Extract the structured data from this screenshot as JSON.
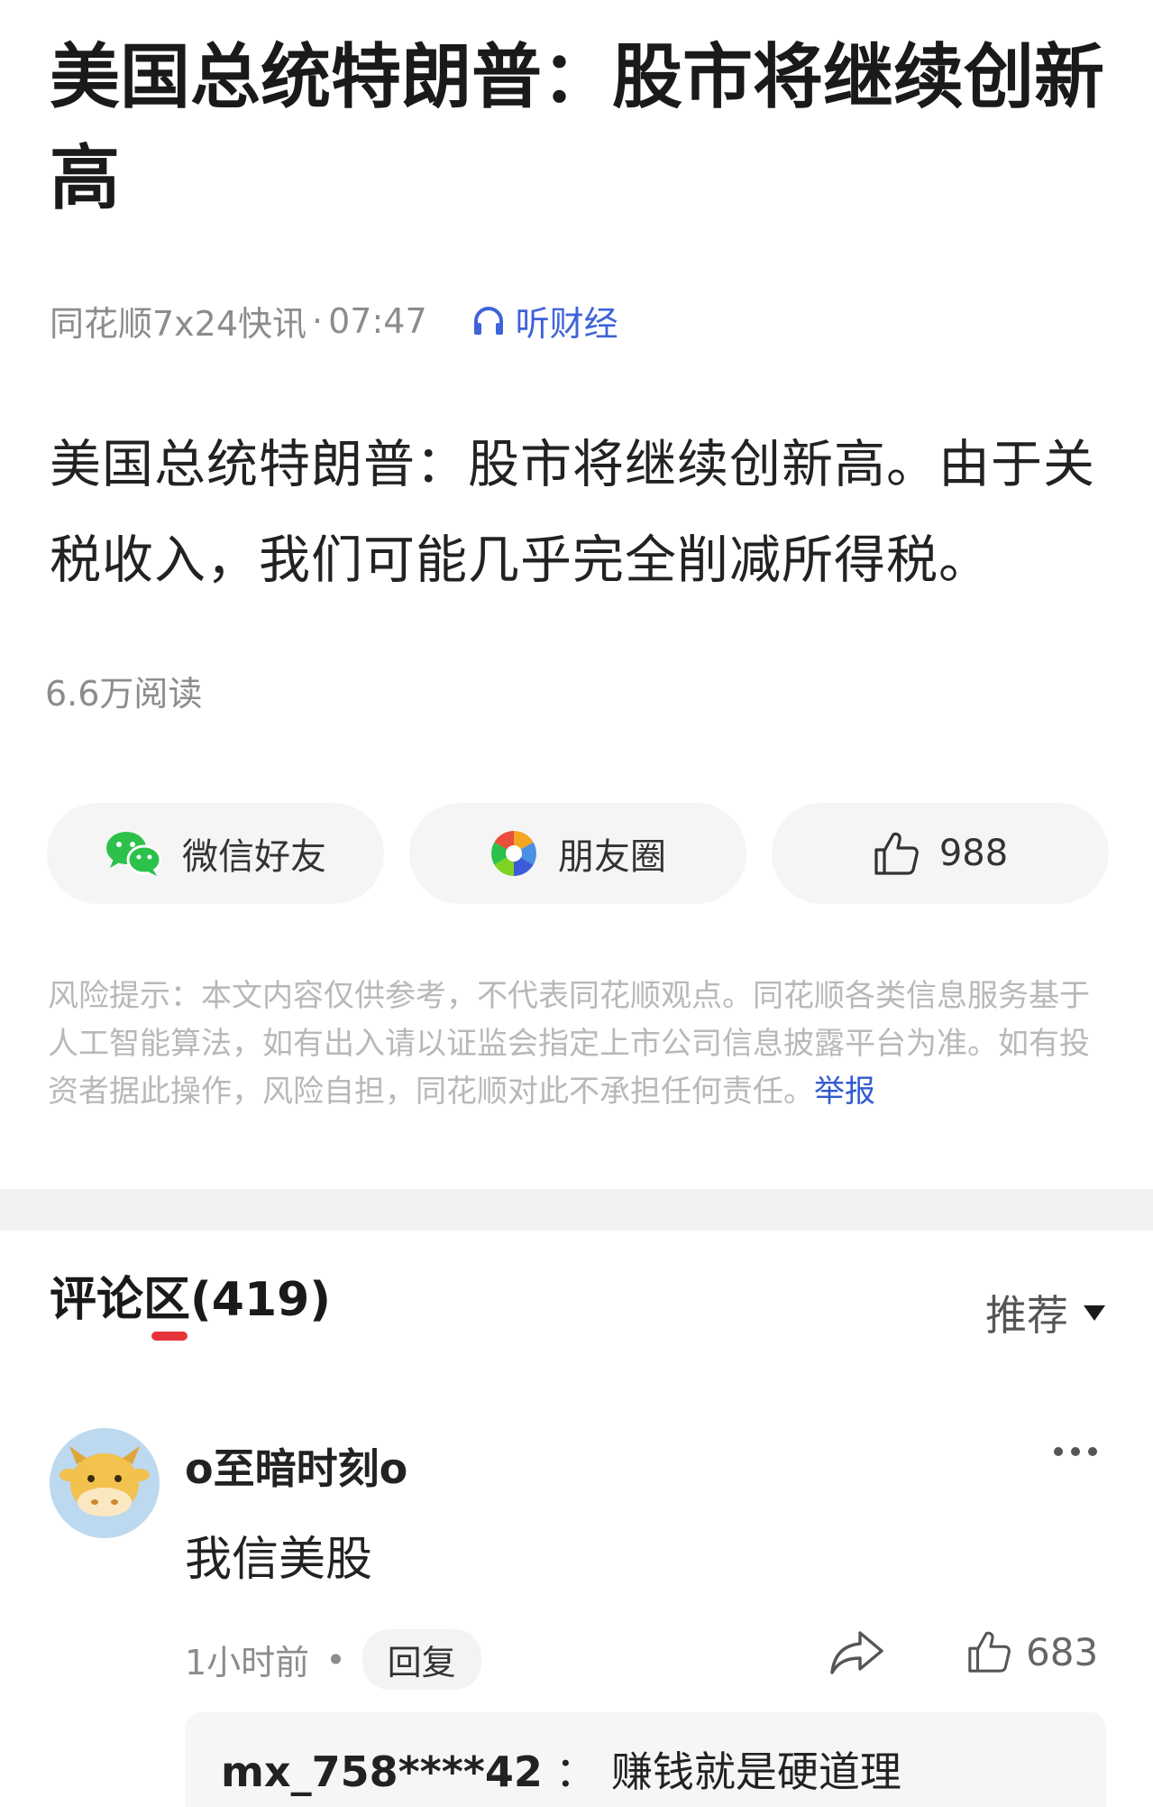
{
  "article": {
    "title": "美国总统特朗普：股市将继续创新高",
    "source": "同花顺7x24快讯",
    "separator": "·",
    "time": "07:47",
    "listen_label": "听财经",
    "body": "美国总统特朗普：股市将继续创新高。由于关税收入，我们可能几乎完全削减所得税。",
    "reads": "6.6万阅读"
  },
  "actions": {
    "wechat_label": "微信好友",
    "moments_label": "朋友圈",
    "like_count": "988"
  },
  "risk": {
    "text": "风险提示：本文内容仅供参考，不代表同花顺观点。同花顺各类信息服务基于人工智能算法，如有出入请以证监会指定上市公司信息披露平台为准。如有投资者据此操作，风险自担，同花顺对此不承担任何责任。",
    "report_label": "举报"
  },
  "comments": {
    "header": "评论区(419)",
    "sort_label": "推荐",
    "items": [
      {
        "username": "o至暗时刻o",
        "text": "我信美股",
        "time": "1小时前",
        "dot": "•",
        "reply_label": "回复",
        "likes": "683",
        "sub_reply": {
          "user": "mx_758****42",
          "colon": "：",
          "text": "赚钱就是硬道理"
        }
      }
    ]
  },
  "colors": {
    "accent_blue": "#3f63d8",
    "underline_red": "#e5353b",
    "wechat_green": "#2bc14a"
  }
}
